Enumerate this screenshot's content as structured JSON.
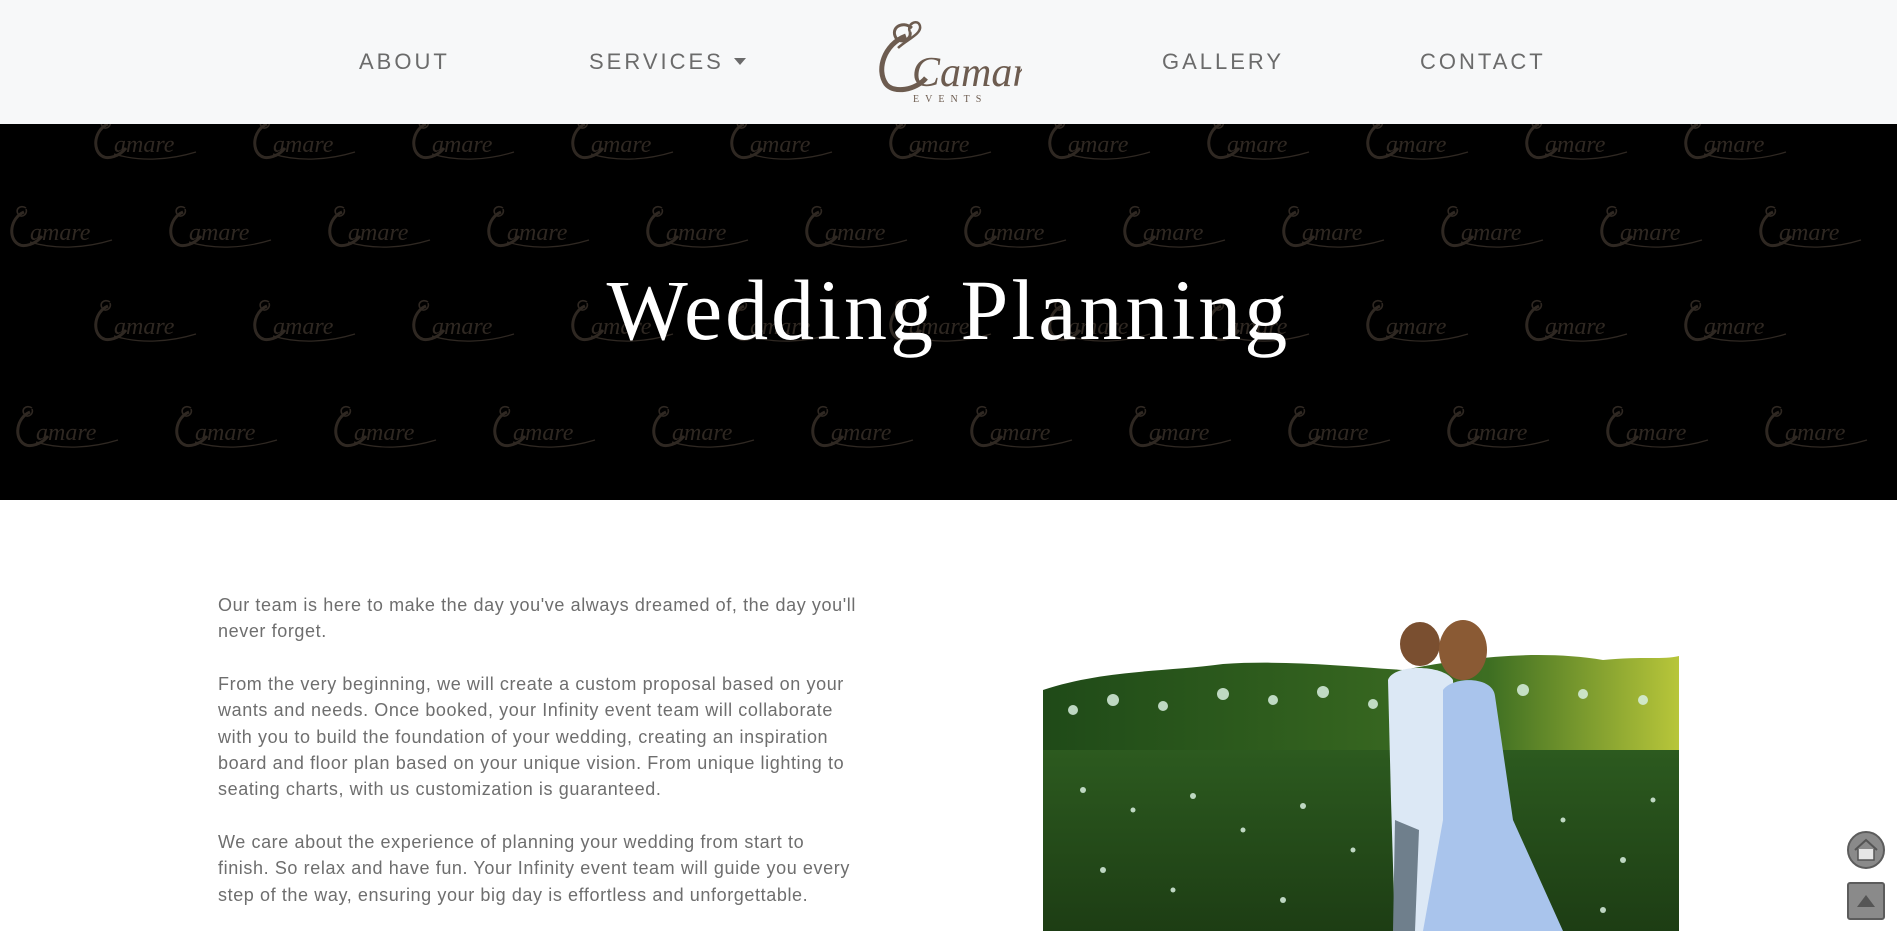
{
  "nav": {
    "about": "ABOUT",
    "services": "SERVICES",
    "gallery": "GALLERY",
    "contact": "CONTACT",
    "logo_text": "Camare",
    "logo_sub": "EVENTS"
  },
  "hero": {
    "title": "Wedding Planning",
    "watermark_text": "Camare"
  },
  "content": {
    "paragraphs": [
      "Our team is here to make the day you've always dreamed of, the day you'll never forget.",
      "From the very beginning, we will create a custom proposal based on your wants and needs. Once booked, your Infinity event team will collaborate with you to build the foundation of your wedding, creating an inspiration board and floor plan based on your unique vision. From unique lighting to seating charts, with us customization is guaranteed.",
      "We care about the experience of planning your wedding from start to finish. So relax and have fun. Your Infinity event team will guide you every step of the way, ensuring your big day is effortless and unforgettable."
    ]
  },
  "colors": {
    "nav_bg": "#f7f8f9",
    "nav_text": "#6b6b6b",
    "hero_bg": "#000000",
    "logo_brown": "#6d5c50",
    "body_text": "#6e6e6e"
  },
  "icons": {
    "home": "home-icon",
    "scroll_top": "arrow-up-icon"
  }
}
